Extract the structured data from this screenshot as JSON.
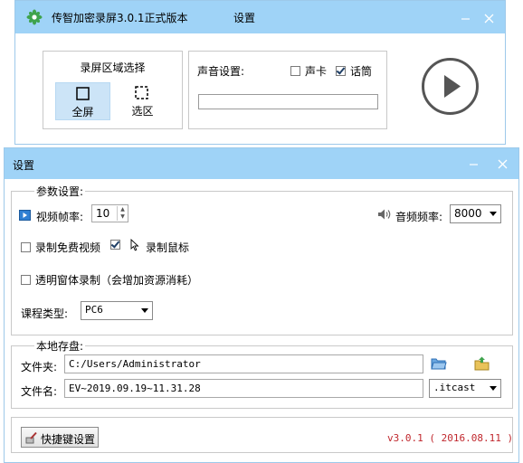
{
  "main_window": {
    "title": "传智加密录屏3.0.1正式版本",
    "settings_link": "设置",
    "region_box": {
      "title": "录屏区域选择",
      "full_label": "全屏",
      "select_label": "选区"
    },
    "sound_box": {
      "label": "声音设置:",
      "soundcard_label": "声卡",
      "soundcard_checked": false,
      "mic_label": "话筒",
      "mic_checked": true
    }
  },
  "settings_window": {
    "title": "设置",
    "params": {
      "group_title": "参数设置:",
      "fps_label": "视频帧率:",
      "fps_value": "10",
      "audio_freq_label": "音频频率:",
      "audio_freq_value": "8000",
      "free_video_label": "录制免费视频",
      "free_video_checked": false,
      "record_mouse_label": "录制鼠标",
      "record_mouse_checked": true,
      "transparent_label": "透明窗体录制（会增加资源消耗）",
      "transparent_checked": false,
      "course_type_label": "课程类型:",
      "course_type_value": "PC6"
    },
    "storage": {
      "group_title": "本地存盘:",
      "folder_label": "文件夹:",
      "folder_value": "C:/Users/Administrator",
      "file_label": "文件名:",
      "file_value": "EV~2019.09.19~11.31.28",
      "ext_value": ".itcast"
    },
    "hotkey_label": "快捷键设置",
    "version": "v3.0.1 ( 2016.08.11 )"
  },
  "colors": {
    "titlebar": "#9fd3f7",
    "version_text": "#c0272d",
    "selected_region": "#cce4f7"
  },
  "icons": [
    "app-logo-icon",
    "minimize-icon",
    "close-icon",
    "play-icon",
    "fullscreen-icon",
    "selection-icon",
    "video-icon",
    "speaker-icon",
    "cursor-icon",
    "folder-browse-icon",
    "folder-open-icon",
    "hotkey-icon"
  ]
}
